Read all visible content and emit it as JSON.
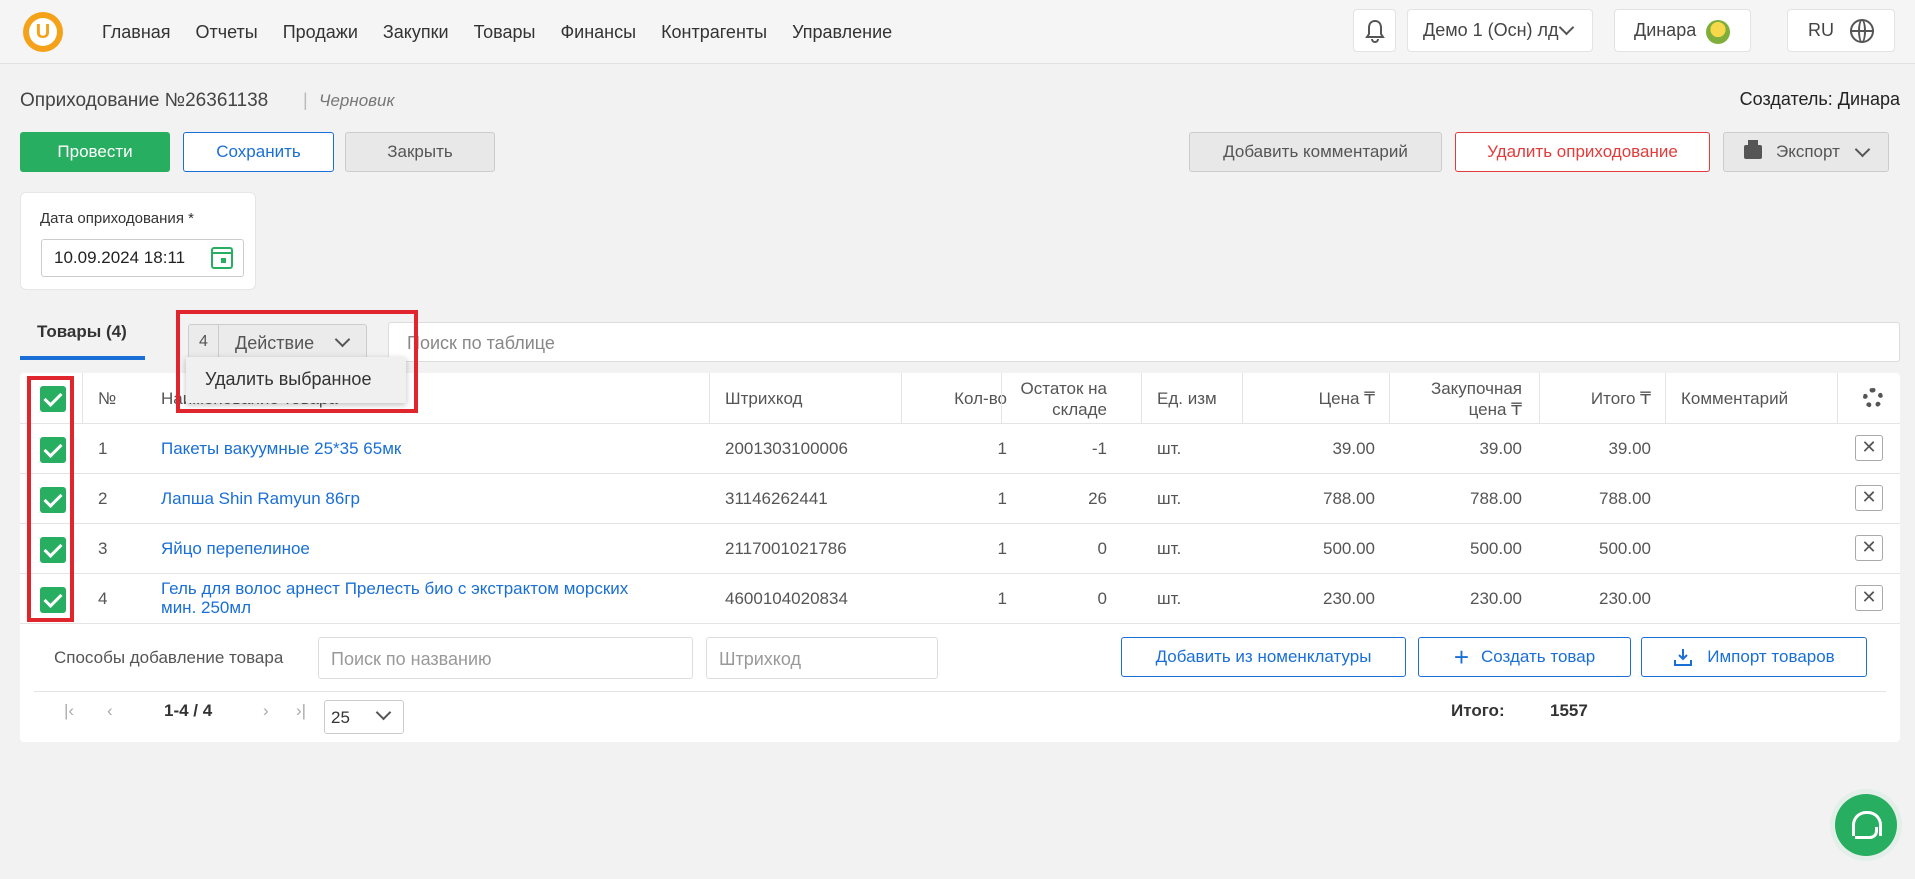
{
  "app": {
    "logo_letter": "U",
    "nav": [
      "Главная",
      "Отчеты",
      "Продажи",
      "Закупки",
      "Товары",
      "Финансы",
      "Контрагенты",
      "Управление"
    ],
    "org": "Демо 1 (Осн) лд",
    "user": "Динара",
    "lang": "RU"
  },
  "doc": {
    "title": "Оприходование №26361138",
    "separator": "|",
    "status": "Черновик",
    "creator": "Создатель: Динара"
  },
  "buttons": {
    "post": "Провести",
    "save": "Сохранить",
    "close": "Закрыть",
    "comment": "Добавить комментарий",
    "delete": "Удалить оприходование",
    "export": "Экспорт"
  },
  "date": {
    "label": "Дата оприходования *",
    "value": "10.09.2024 18:11"
  },
  "tabs": {
    "goods": "Товары  (4)"
  },
  "action": {
    "count": "4",
    "label": "Действие",
    "menu_item": "Удалить выбранное"
  },
  "table_search": {
    "placeholder": "Поиск по таблице"
  },
  "table": {
    "headers": {
      "num": "№",
      "name": "Наименование товара",
      "barcode": "Штрихкод",
      "qty": "Кол-во",
      "stock_line1": "Остаток на",
      "stock_line2": "складе",
      "unit": "Ед. изм",
      "price": "Цена ₸",
      "purchase_line1": "Закупочная",
      "purchase_line2": "цена ₸",
      "total": "Итого ₸",
      "comment": "Комментарий"
    },
    "rows": [
      {
        "num": "1",
        "name": "Пакеты вакуумные 25*35 65мк",
        "barcode": "2001303100006",
        "qty": "1",
        "stock": "-1",
        "unit": "шт.",
        "price": "39.00",
        "purchase": "39.00",
        "total": "39.00"
      },
      {
        "num": "2",
        "name": "Лапша Shin Ramyun 86гр",
        "barcode": "31146262441",
        "qty": "1",
        "stock": "26",
        "unit": "шт.",
        "price": "788.00",
        "purchase": "788.00",
        "total": "788.00"
      },
      {
        "num": "3",
        "name": "Яйцо перепелиное",
        "barcode": "2117001021786",
        "qty": "1",
        "stock": "0",
        "unit": "шт.",
        "price": "500.00",
        "purchase": "500.00",
        "total": "500.00"
      },
      {
        "num": "4",
        "name": "Гель для волос арнест Прелесть био с экстрактом морских мин. 250мл",
        "name_line1": "Гель для волос арнест Прелесть био с экстрактом морских",
        "name_line2": "мин. 250мл",
        "barcode": "4600104020834",
        "qty": "1",
        "stock": "0",
        "unit": "шт.",
        "price": "230.00",
        "purchase": "230.00",
        "total": "230.00"
      }
    ]
  },
  "add": {
    "label": "Способы добавление товара",
    "name_placeholder": "Поиск по названию",
    "barcode_placeholder": "Штрихкод",
    "from_catalog": "Добавить из номенклатуры",
    "create": "Создать товар",
    "import": "Импорт товаров"
  },
  "pager": {
    "range": "1-4 / 4",
    "page_size": "25",
    "total_label": "Итого:",
    "total_value": "1557"
  },
  "colors": {
    "green": "#27ae60",
    "blue": "#1a6fd6",
    "red": "#e23b3b",
    "highlight": "#e0262c"
  }
}
